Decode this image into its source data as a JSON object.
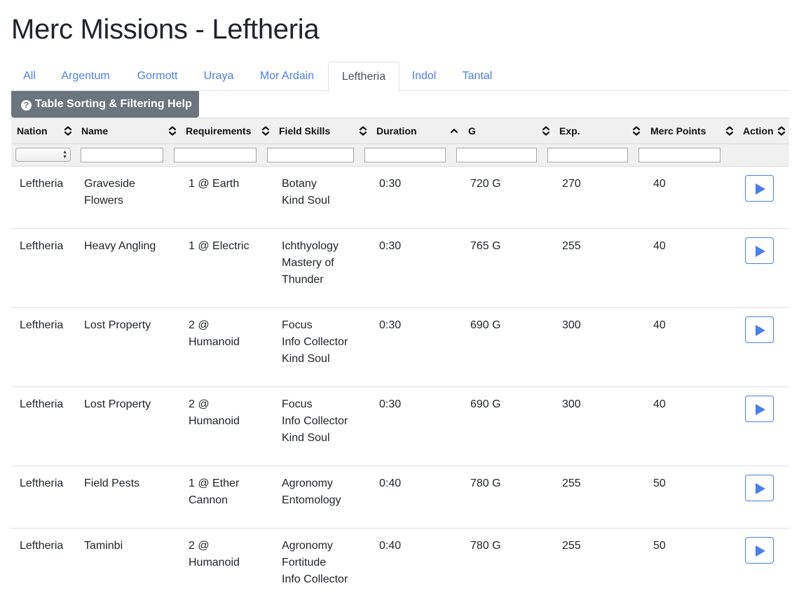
{
  "page": {
    "title": "Merc Missions - Leftheria"
  },
  "tabs": [
    {
      "label": "All"
    },
    {
      "label": "Argentum"
    },
    {
      "label": "Gormott"
    },
    {
      "label": "Uraya"
    },
    {
      "label": "Mor Ardain"
    },
    {
      "label": "Leftheria",
      "active": true
    },
    {
      "label": "Indol"
    },
    {
      "label": "Tantal"
    }
  ],
  "help_button": {
    "label": "Table Sorting & Filtering Help",
    "icon": "question-circle-icon"
  },
  "table": {
    "columns": [
      {
        "label": "Nation",
        "sort": "none"
      },
      {
        "label": "Name",
        "sort": "none"
      },
      {
        "label": "Requirements",
        "sort": "none"
      },
      {
        "label": "Field Skills",
        "sort": "none"
      },
      {
        "label": "Duration",
        "sort": "ascending"
      },
      {
        "label": "G",
        "sort": "none"
      },
      {
        "label": "Exp.",
        "sort": "none"
      },
      {
        "label": "Merc Points",
        "sort": "none"
      },
      {
        "label": "Action",
        "sort": "none"
      }
    ],
    "filters": {
      "nation_select": "",
      "name": "",
      "requirements": "",
      "field_skills": "",
      "duration": "",
      "g": "",
      "exp": "",
      "merc_points": ""
    },
    "rows": [
      {
        "nation": "Leftheria",
        "name": [
          "Graveside",
          "Flowers"
        ],
        "requirements": [
          "1 @ Earth"
        ],
        "field_skills": [
          "Botany",
          "Kind Soul"
        ],
        "duration": "0:30",
        "g": "720 G",
        "exp": "270",
        "merc_points": "40",
        "action_icon": "play-icon"
      },
      {
        "nation": "Leftheria",
        "name": [
          "Heavy Angling"
        ],
        "requirements": [
          "1 @ Electric"
        ],
        "field_skills": [
          "Ichthyology",
          "Mastery of",
          "Thunder"
        ],
        "duration": "0:30",
        "g": "765 G",
        "exp": "255",
        "merc_points": "40",
        "action_icon": "play-icon"
      },
      {
        "nation": "Leftheria",
        "name": [
          "Lost Property"
        ],
        "requirements": [
          "2 @",
          "Humanoid"
        ],
        "field_skills": [
          "Focus",
          "Info Collector",
          "Kind Soul"
        ],
        "duration": "0:30",
        "g": "690 G",
        "exp": "300",
        "merc_points": "40",
        "action_icon": "play-icon"
      },
      {
        "nation": "Leftheria",
        "name": [
          "Lost Property"
        ],
        "requirements": [
          "2 @",
          "Humanoid"
        ],
        "field_skills": [
          "Focus",
          "Info Collector",
          "Kind Soul"
        ],
        "duration": "0:30",
        "g": "690 G",
        "exp": "300",
        "merc_points": "40",
        "action_icon": "play-icon"
      },
      {
        "nation": "Leftheria",
        "name": [
          "Field Pests"
        ],
        "requirements": [
          "1 @ Ether",
          "Cannon"
        ],
        "field_skills": [
          "Agronomy",
          "Entomology"
        ],
        "duration": "0:40",
        "g": "780 G",
        "exp": "255",
        "merc_points": "50",
        "action_icon": "play-icon"
      },
      {
        "nation": "Leftheria",
        "name": [
          "Taminbi"
        ],
        "requirements": [
          "2 @",
          "Humanoid"
        ],
        "field_skills": [
          "Agronomy",
          "Fortitude",
          "Info Collector"
        ],
        "duration": "0:40",
        "g": "780 G",
        "exp": "255",
        "merc_points": "50",
        "action_icon": "play-icon"
      }
    ]
  },
  "colors": {
    "link": "#4a7ee8",
    "help_button_bg": "#6c757d",
    "header_bg": "#f0f0f0",
    "text": "#212529"
  }
}
